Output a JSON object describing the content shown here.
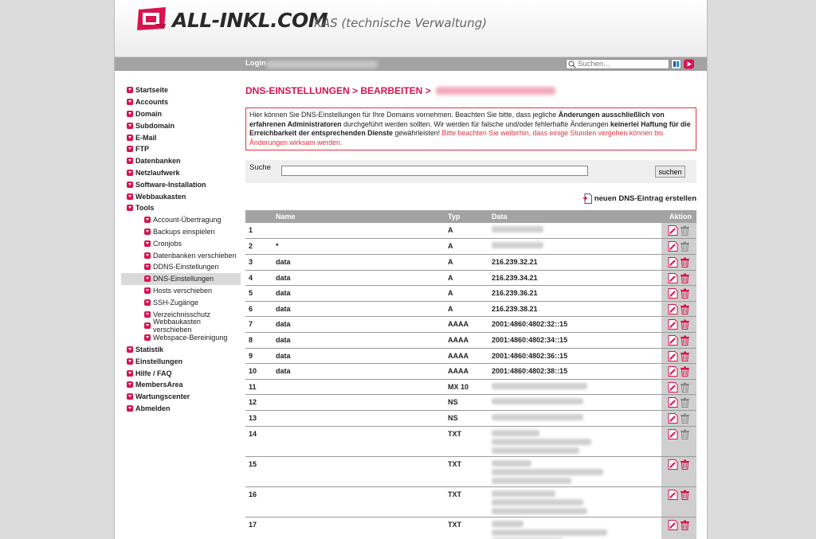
{
  "brand": {
    "logo_text": "ALL-INKL.COM",
    "subtitle": "KAS (technische Verwaltung)"
  },
  "topbar": {
    "login_label": "Login",
    "search_placeholder": "Suchen..."
  },
  "sidebar": {
    "items": [
      {
        "label": "Startseite",
        "level": 0
      },
      {
        "label": "Accounts",
        "level": 0
      },
      {
        "label": "Domain",
        "level": 0
      },
      {
        "label": "Subdomain",
        "level": 0
      },
      {
        "label": "E-Mail",
        "level": 0
      },
      {
        "label": "FTP",
        "level": 0
      },
      {
        "label": "Datenbanken",
        "level": 0
      },
      {
        "label": "Netzlaufwerk",
        "level": 0
      },
      {
        "label": "Software-Installation",
        "level": 0
      },
      {
        "label": "Webbaukasten",
        "level": 0
      },
      {
        "label": "Tools",
        "level": 0
      },
      {
        "label": "Account-Übertragung",
        "level": 1
      },
      {
        "label": "Backups einspielen",
        "level": 1
      },
      {
        "label": "Cronjobs",
        "level": 1
      },
      {
        "label": "Datenbanken verschieben",
        "level": 1
      },
      {
        "label": "DDNS-Einstellungen",
        "level": 1
      },
      {
        "label": "DNS-Einstellungen",
        "level": 1,
        "active": true
      },
      {
        "label": "Hosts verschieben",
        "level": 1
      },
      {
        "label": "SSH-Zugänge",
        "level": 1
      },
      {
        "label": "Verzeichnisschutz",
        "level": 1
      },
      {
        "label": "Webbaukasten verschieben",
        "level": 1
      },
      {
        "label": "Webspace-Bereinigung",
        "level": 1
      },
      {
        "label": "Statistik",
        "level": 0
      },
      {
        "label": "Einstellungen",
        "level": 0
      },
      {
        "label": "Hilfe / FAQ",
        "level": 0
      },
      {
        "label": "MembersArea",
        "level": 0
      },
      {
        "label": "Wartungscenter",
        "level": 0
      },
      {
        "label": "Abmelden",
        "level": 0
      }
    ]
  },
  "main": {
    "title": "DNS-EINSTELLUNGEN > BEARBEITEN >",
    "notice": {
      "p1": "Hier können Sie DNS-Einstellungen für Ihre Domains vornehmen. Beachten Sie bitte, dass jegliche ",
      "b1": "Änderungen ausschließlich von erfahrenen Administratoren",
      "p2": " durchgeführt werden sollten. Wir werden für falsche und/oder fehlerhafte Änderungen ",
      "b2": "keinerlei Haftung für die Erreichbarkeit der entsprechenden Dienste",
      "p3": " gewährleisten! ",
      "red": "Bitte beachten Sie weiterhin, dass einige Stunden vergehen können bis Änderungen wirksam werden."
    },
    "search": {
      "label": "Suche",
      "button": "suchen"
    },
    "create_label": "neuen DNS-Eintrag erstellen",
    "table": {
      "headers": {
        "nr": "",
        "name": "Name",
        "type": "Typ",
        "data": "Data",
        "action": "Aktion"
      },
      "rows": [
        {
          "nr": "1",
          "name": "",
          "type": "A",
          "data": "",
          "blurred": true,
          "lines": 1,
          "locked": true
        },
        {
          "nr": "2",
          "name": "*",
          "type": "A",
          "data": "",
          "blurred": true,
          "lines": 1,
          "locked": true
        },
        {
          "nr": "3",
          "name": "data",
          "type": "A",
          "data": "216.239.32.21",
          "lines": 1
        },
        {
          "nr": "4",
          "name": "data",
          "type": "A",
          "data": "216.239.34.21",
          "lines": 1
        },
        {
          "nr": "5",
          "name": "data",
          "type": "A",
          "data": "216.239.36.21",
          "lines": 1
        },
        {
          "nr": "6",
          "name": "data",
          "type": "A",
          "data": "216.239.38.21",
          "lines": 1
        },
        {
          "nr": "7",
          "name": "data",
          "type": "AAAA",
          "data": "2001:4860:4802:32::15",
          "lines": 1
        },
        {
          "nr": "8",
          "name": "data",
          "type": "AAAA",
          "data": "2001:4860:4802:34::15",
          "lines": 1
        },
        {
          "nr": "9",
          "name": "data",
          "type": "AAAA",
          "data": "2001:4860:4802:36::15",
          "lines": 1
        },
        {
          "nr": "10",
          "name": "data",
          "type": "AAAA",
          "data": "2001:4860:4802:38::15",
          "lines": 1
        },
        {
          "nr": "11",
          "name": "",
          "type": "MX 10",
          "data": "",
          "blurred": true,
          "lines": 1,
          "locked": true
        },
        {
          "nr": "12",
          "name": "",
          "type": "NS",
          "data": "",
          "blurred": true,
          "lines": 1,
          "locked": true
        },
        {
          "nr": "13",
          "name": "",
          "type": "NS",
          "data": "",
          "blurred": true,
          "lines": 1,
          "locked": true
        },
        {
          "nr": "14",
          "name": "",
          "type": "TXT",
          "data": "",
          "blurred": true,
          "lines": 3,
          "locked": true
        },
        {
          "nr": "15",
          "name": "",
          "type": "TXT",
          "data": "",
          "blurred": true,
          "lines": 3
        },
        {
          "nr": "16",
          "name": "",
          "type": "TXT",
          "data": "",
          "blurred": true,
          "lines": 3
        },
        {
          "nr": "17",
          "name": "",
          "type": "TXT",
          "data": "",
          "blurred": true,
          "lines": 3
        }
      ]
    }
  },
  "colors": {
    "accent": "#d8144e",
    "header_bar": "#a3a3a3",
    "notice_border": "#e0323e"
  }
}
